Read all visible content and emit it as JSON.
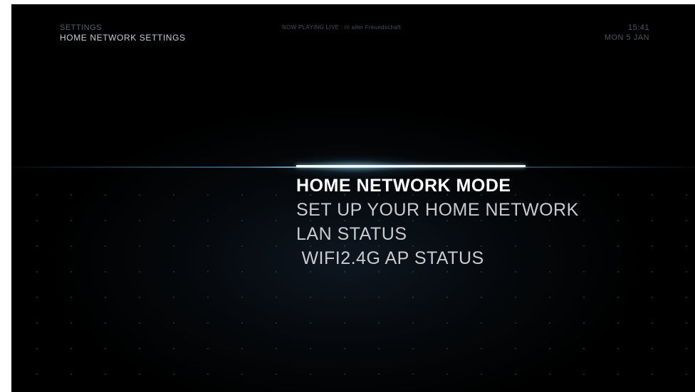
{
  "header": {
    "breadcrumb_parent": "SETTINGS",
    "breadcrumb_current": "HOME NETWORK SETTINGS",
    "now_playing": "NOW PLAYING LIVE : In aller Freundschaft"
  },
  "clock": {
    "time": "15:41",
    "date": "MON 5 JAN"
  },
  "menu": {
    "items": [
      {
        "label": "HOME NETWORK MODE",
        "selected": true
      },
      {
        "label": "SET UP YOUR HOME NETWORK",
        "selected": false
      },
      {
        "label": "LAN STATUS",
        "selected": false
      },
      {
        "label": " WIFI2.4G AP STATUS",
        "selected": false
      }
    ]
  },
  "colors": {
    "background": "#000000",
    "text_primary": "#ffffff",
    "text_secondary": "#c8ccd0",
    "accent_glow": "#8fd3ef"
  }
}
